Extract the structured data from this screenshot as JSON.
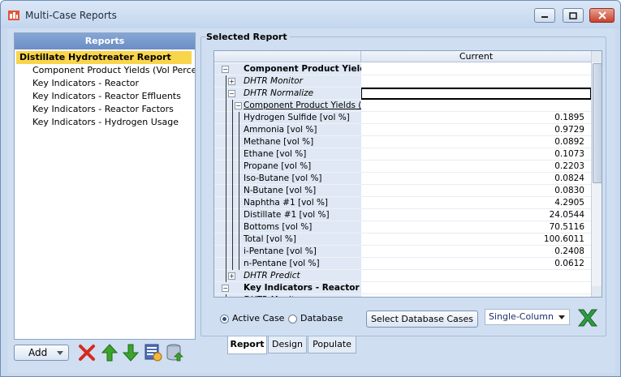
{
  "window": {
    "title": "Multi-Case Reports"
  },
  "left_panel": {
    "header": "Reports",
    "items": [
      {
        "label": "Distillate Hydrotreater Report",
        "selected": true
      },
      {
        "label": "Component Product Yields (Vol Percen"
      },
      {
        "label": "Key Indicators - Reactor"
      },
      {
        "label": "Key Indicators - Reactor Effluents"
      },
      {
        "label": "Key Indicators - Reactor Factors"
      },
      {
        "label": "Key Indicators - Hydrogen Usage"
      }
    ],
    "add_label": "Add"
  },
  "report": {
    "group_label": "Selected Report",
    "column_header": "Current",
    "rows": [
      {
        "label": "Component Product Yields (",
        "value": "",
        "style": "bold",
        "expander": "minus",
        "indent": 0
      },
      {
        "label": "DHTR Monitor",
        "value": "",
        "style": "italic",
        "expander": "plus",
        "indent": 1
      },
      {
        "label": "DHTR Normalize",
        "value": "",
        "style": "italic",
        "expander": "minus",
        "indent": 1
      },
      {
        "label": "Component Product Yields (V",
        "value": "",
        "style": "underline",
        "expander": "minus",
        "indent": 2
      },
      {
        "label": "Hydrogen Sulfide [vol %]",
        "value": "0.1895",
        "indent": 3
      },
      {
        "label": "Ammonia [vol %]",
        "value": "0.9729",
        "indent": 3
      },
      {
        "label": "Methane [vol %]",
        "value": "0.0892",
        "indent": 3
      },
      {
        "label": "Ethane [vol %]",
        "value": "0.1073",
        "indent": 3
      },
      {
        "label": "Propane [vol %]",
        "value": "0.2203",
        "indent": 3
      },
      {
        "label": "Iso-Butane [vol %]",
        "value": "0.0824",
        "indent": 3
      },
      {
        "label": "N-Butane [vol %]",
        "value": "0.0830",
        "indent": 3
      },
      {
        "label": "Naphtha #1 [vol %]",
        "value": "4.2905",
        "indent": 3
      },
      {
        "label": "Distillate #1 [vol %]",
        "value": "24.0544",
        "indent": 3
      },
      {
        "label": "Bottoms [vol %]",
        "value": "70.5116",
        "indent": 3
      },
      {
        "label": "Total [vol %]",
        "value": "100.6011",
        "indent": 3
      },
      {
        "label": "i-Pentane [vol %]",
        "value": "0.2408",
        "indent": 3
      },
      {
        "label": "n-Pentane [vol %]",
        "value": "0.0612",
        "indent": 3
      },
      {
        "label": "DHTR Predict",
        "value": "",
        "style": "italic",
        "expander": "plus",
        "indent": 1
      },
      {
        "label": "Key Indicators - Reactor",
        "value": "",
        "style": "bold",
        "expander": "minus",
        "indent": 0
      },
      {
        "label": "DHTR Monitor",
        "value": "",
        "style": "italic",
        "expander": "plus",
        "indent": 1
      }
    ]
  },
  "controls": {
    "active_case_label": "Active Case",
    "database_label": "Database",
    "active_case_checked": true,
    "select_db_button": "Select Database Cases",
    "layout_selected": "Single-Column"
  },
  "tabs": [
    "Report",
    "Design",
    "Populate"
  ],
  "colors": {
    "accent": "#f9d54b",
    "header": "#6b8ec5",
    "label_bg": "#dfe8f4"
  }
}
